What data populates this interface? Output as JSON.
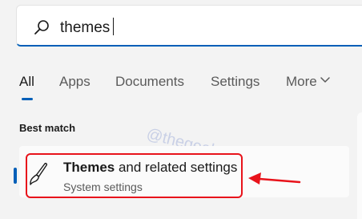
{
  "search": {
    "query": "themes"
  },
  "tabs": [
    {
      "label": "All"
    },
    {
      "label": "Apps"
    },
    {
      "label": "Documents"
    },
    {
      "label": "Settings"
    },
    {
      "label": "More"
    }
  ],
  "section": {
    "label": "Best match"
  },
  "watermark": {
    "text": "@thegeekpage.com"
  },
  "result": {
    "title_bold": "Themes",
    "title_rest": " and related settings",
    "subtitle": "System settings",
    "icon": "brush-icon"
  },
  "colors": {
    "accent": "#005fb8",
    "annotation": "#e8131b"
  }
}
